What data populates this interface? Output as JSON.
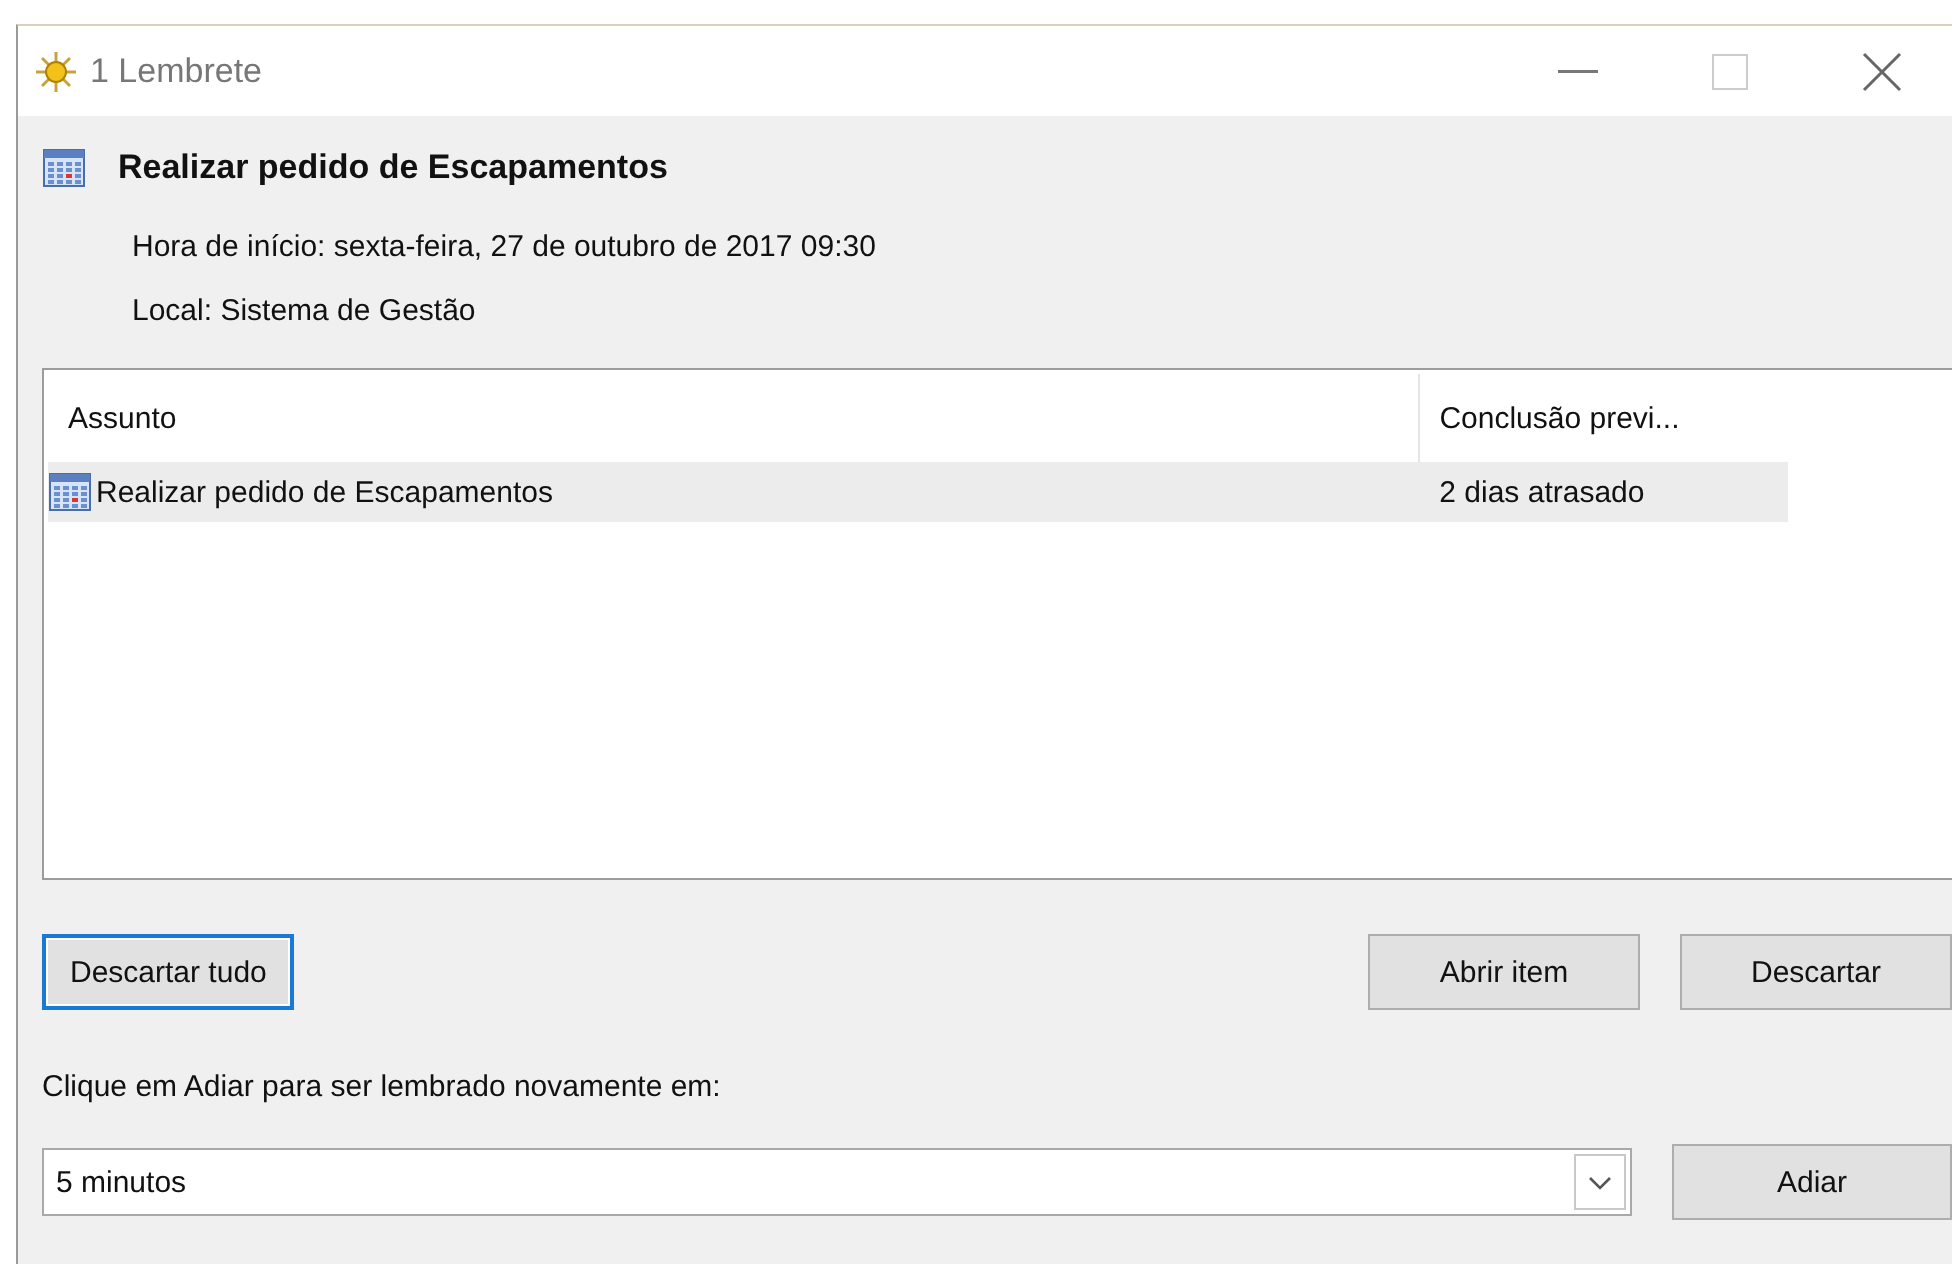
{
  "window": {
    "title": "1 Lembrete"
  },
  "reminder": {
    "title": "Realizar pedido de Escapamentos",
    "start": "Hora de início: sexta-feira, 27 de outubro de 2017 09:30",
    "location": "Local: Sistema de Gestão"
  },
  "table": {
    "columns": [
      "Assunto",
      "Conclusão previ..."
    ],
    "rows": [
      {
        "subject": "Realizar pedido de Escapamentos",
        "due": "2 dias atrasado",
        "selected": true
      }
    ]
  },
  "buttons": [
    {
      "label": "Descartar tudo",
      "focused": true
    },
    {
      "label": "Abrir item",
      "focused": false
    },
    {
      "label": "Descartar",
      "focused": false
    }
  ],
  "snooze": {
    "prompt": "Clique em Adiar para ser lembrado novamente em:",
    "value": "5 minutos",
    "button": "Adiar"
  }
}
